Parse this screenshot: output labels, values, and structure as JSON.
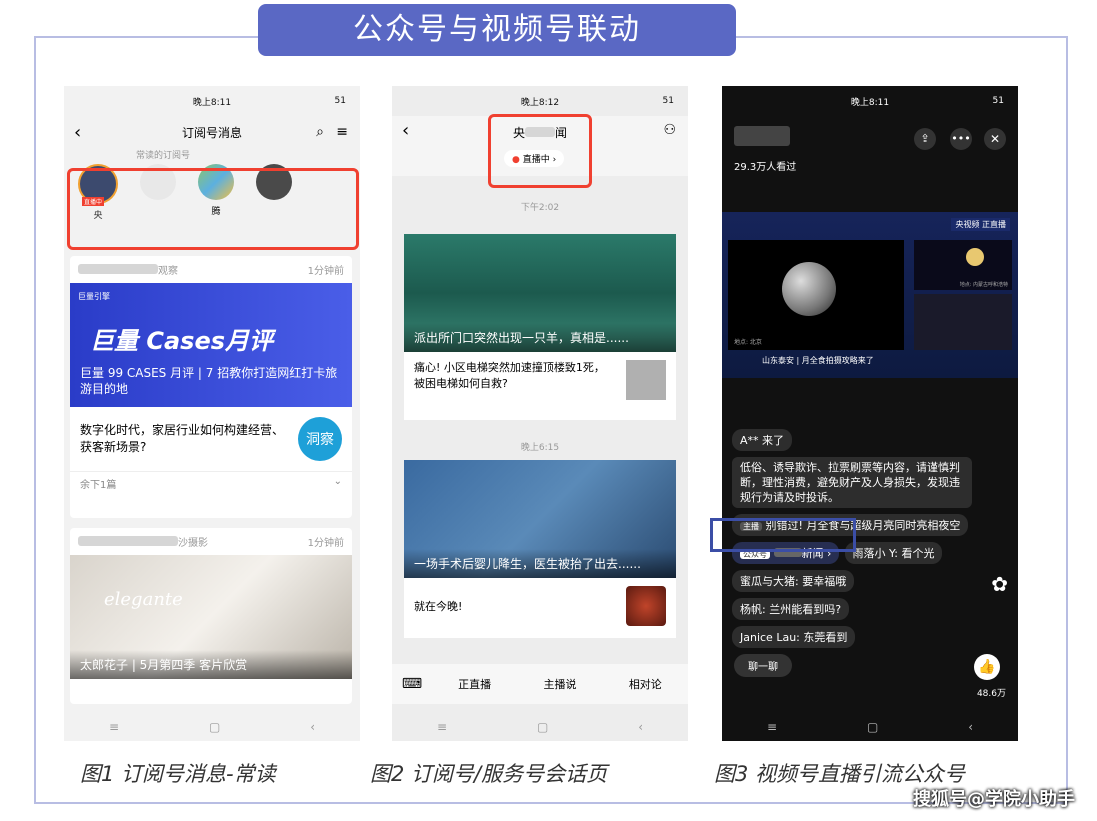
{
  "banner_title": "公众号与视频号联动",
  "watermark": "搜狐号@学院小助手",
  "phone1": {
    "time": "晚上8:11",
    "status_right": "51",
    "title": "订阅号消息",
    "section_label": "常读的订阅号",
    "live_tag": "直播中",
    "avatar_labels": [
      "央",
      "",
      "腾",
      ""
    ],
    "card1": {
      "name_suffix": "观察",
      "time": "1分钟前",
      "brand": "巨量引擎",
      "banner_big": "巨量 Cases月评",
      "headline": "巨量 99 CASES 月评 | 7 招教你打造网红打卡旅游目的地",
      "item_text": "数字化时代，家居行业如何构建经营、获客新场景?",
      "item_badge": "洞察",
      "more": "余下1篇"
    },
    "card2": {
      "name_suffix": "沙摄影",
      "time": "1分钟前",
      "img_text": "elegante",
      "headline": "太郎花子 | 5月第四季 客片欣赏"
    }
  },
  "phone2": {
    "time": "晚上8:12",
    "title": "央",
    "title_suffix": "闻",
    "live_pill": "直播中",
    "time1": "下午2:02",
    "news1_headline": "派出所门口突然出现一只羊，真相是......",
    "news1_sub": "痛心! 小区电梯突然加速撞顶楼致1死，被困电梯如何自救?",
    "time2": "晚上6:15",
    "news2_headline": "一场手术后婴儿降生，医生被抬了出去......",
    "news2_sub": "就在今晚!",
    "bottom_tabs": [
      "正直播",
      "主播说",
      "相对论"
    ]
  },
  "phone3": {
    "time": "晚上8:11",
    "viewers": "29.3万人看过",
    "video_logo": "央视频 正直播",
    "video_caption": "山东泰安 | 月全食拍摄攻略来了",
    "small_label1": "地点: 内蒙古呼和浩特",
    "small_label2": "地点: 北京",
    "chat": [
      "A** 来了",
      "低俗、诱导欺诈、拉票刷票等内容，请谨慎判断，理性消费，避免财产及人身损失，发现违规行为请及时投诉。",
      "别错过! 月全食与超级月亮同时亮相夜空",
      "雨落小 Y: 看个光",
      "蜜瓜与大猪: 要幸福哦",
      "杨帆: 兰州能看到吗?",
      "Janice Lau: 东莞看到"
    ],
    "host_tag": "主播",
    "gzh_tag": "公众号",
    "gzh_name": "新闻",
    "comment_placeholder": "聊一聊",
    "likes": "48.6万"
  },
  "captions": [
    "图1 订阅号消息-常读",
    "图2 订阅号/服务号会话页",
    "图3 视频号直播引流公众号"
  ],
  "colors": {
    "banner": "#5a68c4",
    "highlight_red": "#f04030",
    "highlight_blue": "#3b4ea6"
  }
}
